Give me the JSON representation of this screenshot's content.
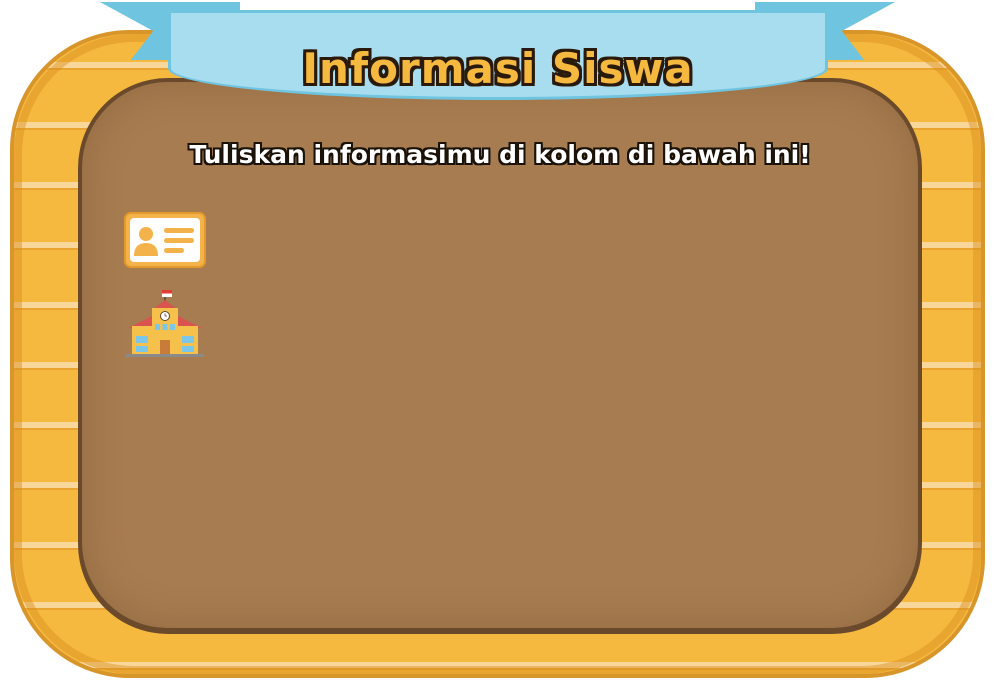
{
  "banner": {
    "title": "Informasi Siswa"
  },
  "instruction": {
    "text": "Tuliskan informasimu di kolom di bawah ini!"
  },
  "icons": [
    {
      "name": "id-card-icon"
    },
    {
      "name": "school-icon"
    }
  ],
  "colors": {
    "frame_wood": "#f6b93f",
    "board": "#a77c50",
    "ribbon": "#a8dcef",
    "title_fill": "#f6b93f",
    "instruction_fill": "#ffffff"
  }
}
